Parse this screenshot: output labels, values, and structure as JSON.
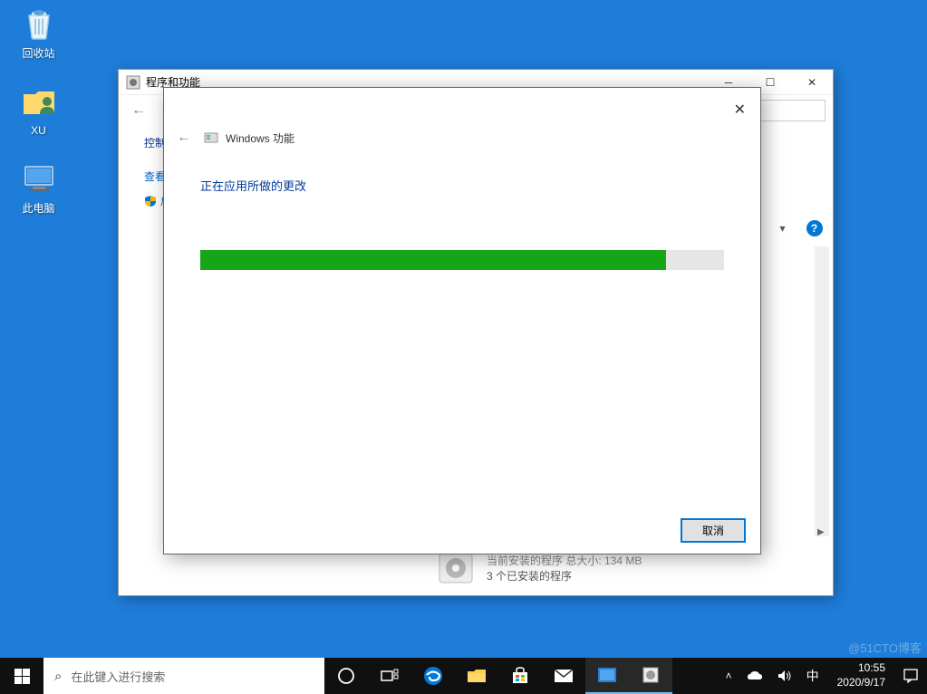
{
  "desktop": {
    "icons": [
      {
        "label": "回收站",
        "name": "recycle-bin-icon"
      },
      {
        "label": "XU",
        "name": "folder-user-icon"
      },
      {
        "label": "此电脑",
        "name": "this-pc-icon"
      }
    ]
  },
  "programs_window": {
    "title": "程序和功能",
    "sidebar": {
      "heading": "控制",
      "items": [
        {
          "label": "查看"
        },
        {
          "label": "启用",
          "shield": true
        }
      ]
    },
    "footer": {
      "line1": "当前安装的程序 总大小: 134 MB",
      "line2": "3 个已安装的程序"
    }
  },
  "features_dialog": {
    "title": "Windows 功能",
    "status_text": "正在应用所做的更改",
    "progress_percent": 89,
    "cancel_label": "取消"
  },
  "taskbar": {
    "search_placeholder": "在此键入进行搜索",
    "ime": "中",
    "time": "10:55",
    "date": "2020/9/17"
  },
  "watermark": "@51CTO博客"
}
